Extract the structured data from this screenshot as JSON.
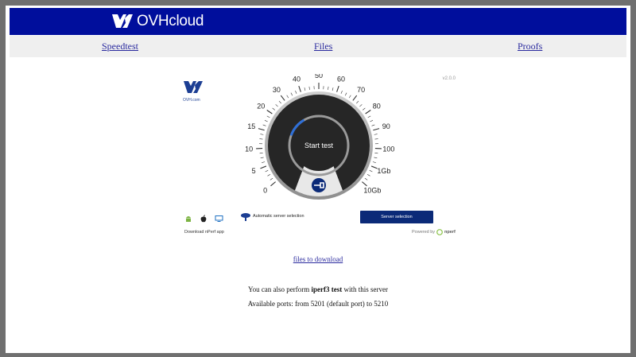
{
  "header": {
    "brand": "OVHcloud"
  },
  "nav": {
    "speedtest": "Speedtest",
    "files": "Files",
    "proofs": "Proofs"
  },
  "widget": {
    "version": "v2.0.0",
    "brand_small": "OVH.com",
    "start_label": "Start test",
    "gauge_ticks": [
      "0",
      "5",
      "10",
      "15",
      "20",
      "30",
      "40",
      "50",
      "60",
      "70",
      "80",
      "90",
      "100",
      "1Gb",
      "10Gb"
    ],
    "auto_server": "Automatic server selection",
    "server_button": "Server selection",
    "download_app": "Download nPerf app",
    "powered_by": "Powered by",
    "nperf_brand": "nperf",
    "icons": [
      "android-icon",
      "apple-icon",
      "desktop-icon"
    ]
  },
  "content": {
    "files_link": "files to download",
    "info_prefix": "You can also perform ",
    "info_bold": "iperf3 test",
    "info_suffix": " with this server",
    "ports": "Available ports: from 5201 (default port) to 5210"
  },
  "colors": {
    "header_bg": "#000e9c",
    "nav_bg": "#efefef",
    "button": "#0b2a78"
  }
}
